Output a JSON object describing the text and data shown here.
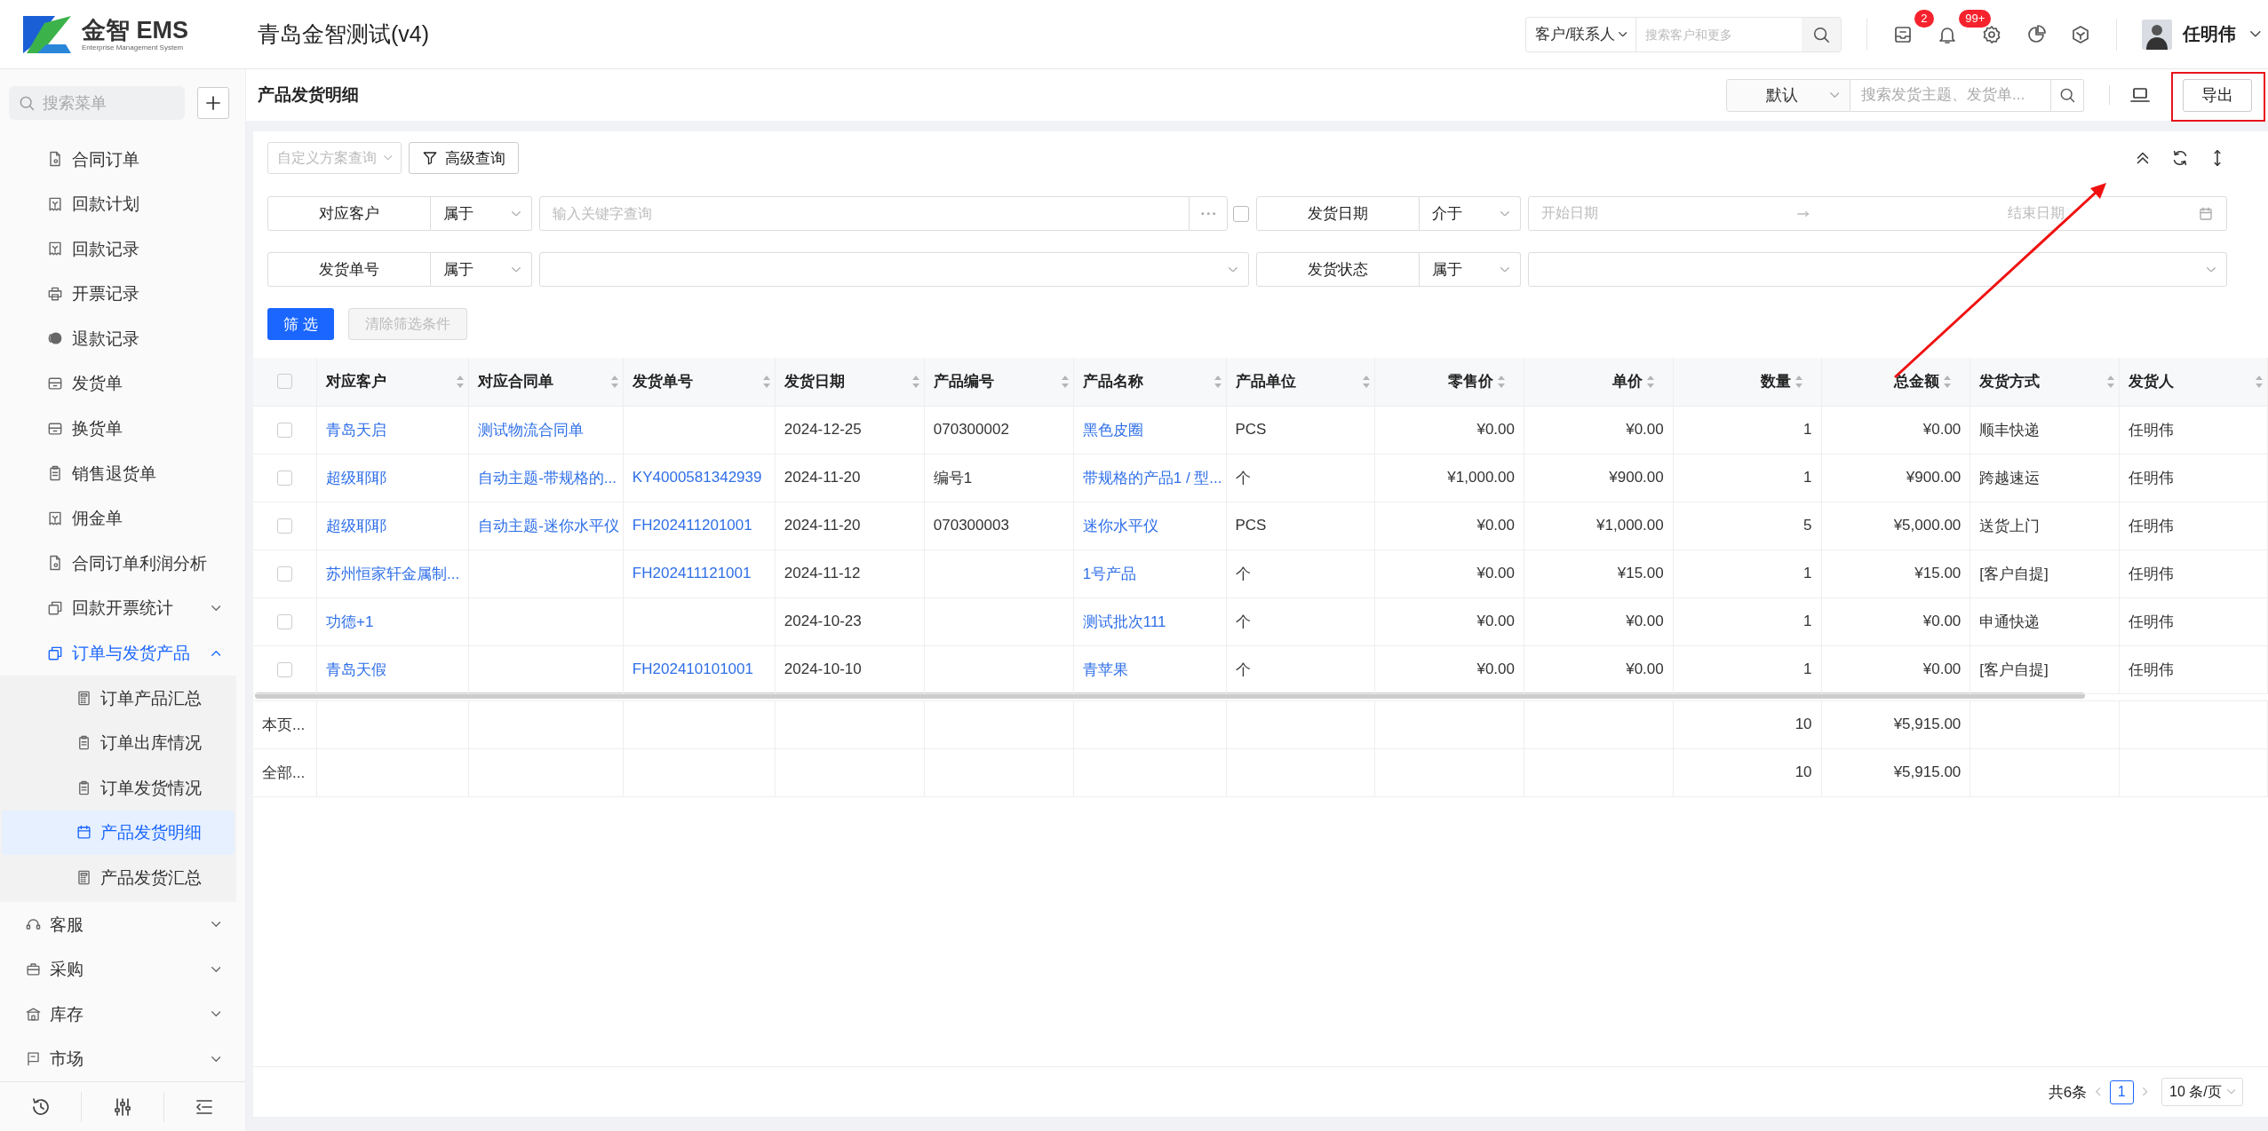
{
  "header": {
    "logo_title": "金智 EMS",
    "logo_subtitle": "Enterprise Management System",
    "app_title": "青岛金智测试(v4)",
    "global_search": {
      "scope": "客户/联系人",
      "placeholder": "搜索客户和更多"
    },
    "notifications": [
      {
        "badge": "2"
      },
      {
        "badge": "99+"
      }
    ],
    "user": {
      "name": "任明伟"
    }
  },
  "sidebar": {
    "search_placeholder": "搜索菜单",
    "section_items": [
      {
        "kind": "link",
        "label": "合同订单",
        "selected": false
      },
      {
        "kind": "link",
        "label": "回款计划",
        "selected": false
      },
      {
        "kind": "link",
        "label": "回款记录",
        "selected": false
      },
      {
        "kind": "link",
        "label": "开票记录",
        "selected": false
      },
      {
        "kind": "link",
        "label": "退款记录",
        "selected": false
      },
      {
        "kind": "link",
        "label": "发货单",
        "selected": false
      },
      {
        "kind": "link",
        "label": "换货单",
        "selected": false
      },
      {
        "kind": "link",
        "label": "销售退货单",
        "selected": false
      },
      {
        "kind": "link",
        "label": "佣金单",
        "selected": false
      },
      {
        "kind": "link",
        "label": "合同订单利润分析",
        "selected": false
      },
      {
        "kind": "group",
        "label": "回款开票统计",
        "expanded": false
      },
      {
        "kind": "group",
        "label": "订单与发货产品",
        "expanded": true,
        "children": [
          {
            "label": "订单产品汇总",
            "selected": false
          },
          {
            "label": "订单出库情况",
            "selected": false
          },
          {
            "label": "订单发货情况",
            "selected": false
          },
          {
            "label": "产品发货明细",
            "selected": true
          },
          {
            "label": "产品发货汇总",
            "selected": false
          }
        ]
      }
    ],
    "modules": [
      {
        "label": "客服",
        "expanded": false
      },
      {
        "label": "采购",
        "expanded": false
      },
      {
        "label": "库存",
        "expanded": false
      },
      {
        "label": "市场",
        "expanded": false
      }
    ]
  },
  "page": {
    "title": "产品发货明细",
    "view": "默认",
    "search_placeholder": "搜索发货主题、发货单...",
    "export_button": "导出"
  },
  "filters": {
    "plan_placeholder": "自定义方案查询",
    "advanced_button": "高级查询",
    "conditions": [
      {
        "kind": "keyword",
        "field": "对应客户",
        "operator": "属于",
        "placeholder": "输入关键字查询",
        "checked": false
      },
      {
        "kind": "date_range",
        "field": "发货日期",
        "operator": "介于",
        "start_placeholder": "开始日期",
        "end_placeholder": "结束日期"
      },
      {
        "kind": "select",
        "field": "发货单号",
        "operator": "属于"
      },
      {
        "kind": "select",
        "field": "发货状态",
        "operator": "属于"
      }
    ],
    "apply_button": "筛 选",
    "clear_button": {
      "label": "清除筛选条件",
      "disabled": true
    }
  },
  "table": {
    "all_checked": false,
    "columns": [
      {
        "label": "对应客户",
        "kind": "link"
      },
      {
        "label": "对应合同单",
        "kind": "link"
      },
      {
        "label": "发货单号",
        "kind": "link"
      },
      {
        "label": "发货日期",
        "kind": "text"
      },
      {
        "label": "产品编号",
        "kind": "text"
      },
      {
        "label": "产品名称",
        "kind": "link"
      },
      {
        "label": "产品单位",
        "kind": "text"
      },
      {
        "label": "零售价",
        "kind": "number"
      },
      {
        "label": "单价",
        "kind": "number"
      },
      {
        "label": "数量",
        "kind": "number"
      },
      {
        "label": "总金额",
        "kind": "number"
      },
      {
        "label": "发货方式",
        "kind": "text"
      },
      {
        "label": "发货人",
        "kind": "text"
      }
    ],
    "rows": [
      {
        "checked": false,
        "cells": [
          "青岛天启",
          "测试物流合同单",
          null,
          "2024-12-25",
          "070300002",
          "黑色皮圈",
          "PCS",
          "¥0.00",
          "¥0.00",
          "1",
          "¥0.00",
          "顺丰快递",
          "任明伟"
        ]
      },
      {
        "checked": false,
        "cells": [
          "超级耶耶",
          "自动主题-带规格的...",
          "KY4000581342939",
          "2024-11-20",
          "编号1",
          "带规格的产品1 / 型...",
          "个",
          "¥1,000.00",
          "¥900.00",
          "1",
          "¥900.00",
          "跨越速运",
          "任明伟"
        ]
      },
      {
        "checked": false,
        "cells": [
          "超级耶耶",
          "自动主题-迷你水平仪",
          "FH202411201001",
          "2024-11-20",
          "070300003",
          "迷你水平仪",
          "PCS",
          "¥0.00",
          "¥1,000.00",
          "5",
          "¥5,000.00",
          "送货上门",
          "任明伟"
        ]
      },
      {
        "checked": false,
        "cells": [
          "苏州恒家轩金属制...",
          null,
          "FH202411121001",
          "2024-11-12",
          null,
          "1号产品",
          "个",
          "¥0.00",
          "¥15.00",
          "1",
          "¥15.00",
          "[客户自提]",
          "任明伟"
        ]
      },
      {
        "checked": false,
        "cells": [
          "功德+1",
          null,
          null,
          "2024-10-23",
          null,
          "测试批次111",
          "个",
          "¥0.00",
          "¥0.00",
          "1",
          "¥0.00",
          "申通快递",
          "任明伟"
        ]
      },
      {
        "checked": false,
        "cells": [
          "青岛天假",
          null,
          "FH202410101001",
          "2024-10-10",
          null,
          "青苹果",
          "个",
          "¥0.00",
          "¥0.00",
          "1",
          "¥0.00",
          "[客户自提]",
          "任明伟"
        ]
      }
    ],
    "summary_rows": [
      {
        "label": "本页...",
        "cells": [
          null,
          null,
          null,
          null,
          null,
          null,
          null,
          null,
          null,
          "10",
          "¥5,915.00",
          null,
          null
        ]
      },
      {
        "label": "全部...",
        "cells": [
          null,
          null,
          null,
          null,
          null,
          null,
          null,
          null,
          null,
          "10",
          "¥5,915.00",
          null,
          null
        ]
      }
    ]
  },
  "pagination": {
    "total": "共6条",
    "pages": [
      {
        "label": "1",
        "selected": true
      }
    ],
    "page_size": "10 条/页"
  }
}
